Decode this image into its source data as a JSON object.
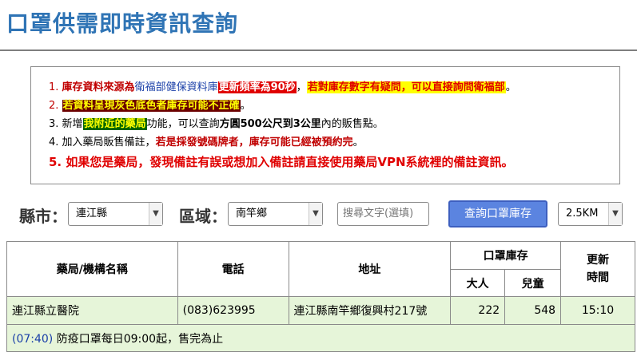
{
  "page": {
    "title": "口罩供需即時資訊查詢"
  },
  "notice": {
    "l1": {
      "num": "1.",
      "a": "庫存資料來源為",
      "b": "衛福部健保資料庫",
      "c": "更新頻率為90秒",
      "d": "，",
      "e": "若對庫存數字有疑問，可以直接詢問衛福部",
      "f": "。"
    },
    "l2": {
      "num": "2.",
      "a": "若資料呈現灰色底色者庫存可能不正確",
      "b": "。"
    },
    "l3": {
      "num": "3.",
      "a": "新增",
      "b": "我附近的藥局",
      "c": "功能，可以查詢",
      "d": "方圓500公尺到3公里",
      "e": "內的販售點。"
    },
    "l4": {
      "num": "4.",
      "a": "加入藥局販售備註，",
      "b": "若是採發號碼牌者，庫存可能已經被預約完",
      "c": "。"
    },
    "l5": {
      "num": "5.",
      "a": "如果您是藥局，發現備註有誤或想加入備註請直接使用藥局VPN系統裡的備註資訊。"
    }
  },
  "filters": {
    "county_label": "縣市：",
    "county_value": "連江縣",
    "district_label": "區域：",
    "district_value": "南竿鄉",
    "search_placeholder": "搜尋文字(選填)",
    "query_button": "查詢口罩庫存",
    "distance_value": "2.5KM"
  },
  "table": {
    "headers": {
      "name": "藥局/機構名稱",
      "phone": "電話",
      "address": "地址",
      "stock": "口罩庫存",
      "adult": "大人",
      "child": "兒童",
      "updated": "更新時間"
    },
    "rows": [
      {
        "name": "連江縣立醫院",
        "phone": "(083)623995",
        "address": "連江縣南竿鄉復興村217號",
        "adult": "222",
        "child": "548",
        "updated": "15:10",
        "note_time": "(07:40)",
        "note_text": " 防疫口罩每日09:00起，售完為止"
      }
    ]
  }
}
